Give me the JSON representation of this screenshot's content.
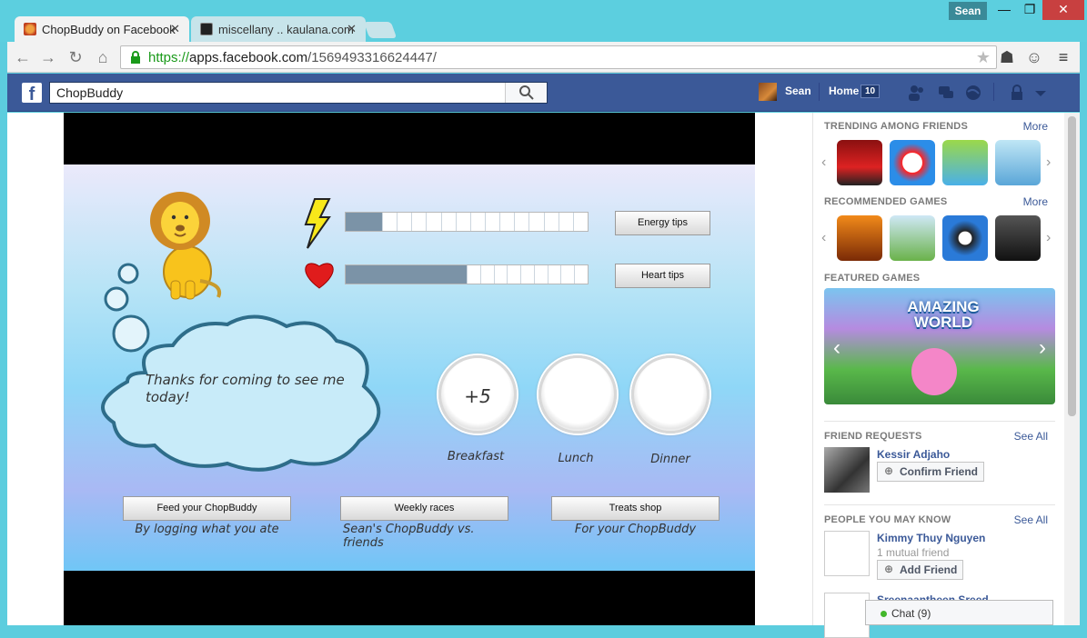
{
  "browser": {
    "tabs": [
      {
        "title": "ChopBuddy on Facebook",
        "active": true
      },
      {
        "title": "miscellany .. kaulana.com",
        "active": false
      }
    ],
    "user": "Sean",
    "url_scheme": "https://",
    "url_host": "apps.facebook.com",
    "url_path": "/1569493316624447/"
  },
  "fb": {
    "search_value": "ChopBuddy",
    "profile_name": "Sean",
    "home_label": "Home",
    "home_count": "10"
  },
  "game": {
    "energy_level": 0.15,
    "heart_level": 0.5,
    "energy_button": "Energy tips",
    "heart_button": "Heart tips",
    "thought": "Thanks for coming to see me today!",
    "meals": [
      {
        "label": "Breakfast",
        "value": "+5"
      },
      {
        "label": "Lunch",
        "value": ""
      },
      {
        "label": "Dinner",
        "value": ""
      }
    ],
    "actions": [
      {
        "label": "Feed your ChopBuddy",
        "caption": "By logging what you ate"
      },
      {
        "label": "Weekly races",
        "caption": "Sean's ChopBuddy vs. friends"
      },
      {
        "label": "Treats shop",
        "caption": "For your ChopBuddy"
      }
    ]
  },
  "sidebar": {
    "trending_title": "TRENDING AMONG FRIENDS",
    "recommended_title": "RECOMMENDED GAMES",
    "featured_title": "FEATURED GAMES",
    "featured_game": "AMAZING WORLD",
    "more_label": "More",
    "friend_requests_title": "FRIEND REQUESTS",
    "people_title": "PEOPLE YOU MAY KNOW",
    "see_all": "See All",
    "request": {
      "name": "Kessir Adjaho",
      "button": "Confirm Friend"
    },
    "suggestions": [
      {
        "name": "Kimmy Thuy Nguyen",
        "mutual": "1 mutual friend",
        "button": "Add Friend"
      },
      {
        "name": "Sreenaantheen Sreed",
        "mutual": "",
        "button": ""
      }
    ],
    "chat_label": "Chat (9)"
  },
  "icons": {
    "theme_accent": "#5ccdde",
    "fb_blue": "#3b5998"
  }
}
